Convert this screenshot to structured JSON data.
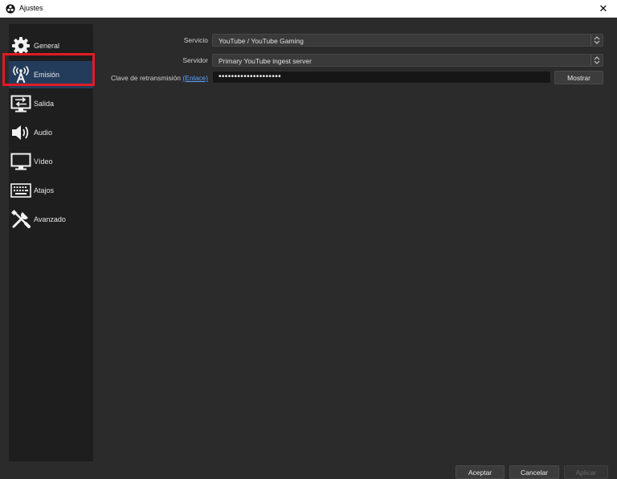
{
  "window": {
    "title": "Ajustes",
    "close_glyph": "✕"
  },
  "sidebar": {
    "items": [
      {
        "label": "General",
        "icon": "gear-icon"
      },
      {
        "label": "Emisión",
        "icon": "broadcast-antenna-icon",
        "active": true
      },
      {
        "label": "Salida",
        "icon": "output-monitor-icon"
      },
      {
        "label": "Audio",
        "icon": "speaker-icon"
      },
      {
        "label": "Vídeo",
        "icon": "monitor-icon"
      },
      {
        "label": "Atajos",
        "icon": "keyboard-icon"
      },
      {
        "label": "Avanzado",
        "icon": "wrench-screwdriver-icon"
      }
    ]
  },
  "stream": {
    "service_label": "Servicio",
    "service_value": "YouTube / YouTube Gaming",
    "server_label": "Servidor",
    "server_value": "Primary YouTube ingest server",
    "key_label": "Clave de retransmisión",
    "key_link": "(Enlace)",
    "key_value": "••••••••••••••••••••",
    "show_button": "Mostrar"
  },
  "footer": {
    "accept": "Aceptar",
    "cancel": "Cancelar",
    "apply": "Aplicar"
  },
  "colors": {
    "background": "#2b2b2b",
    "sidebar": "#1e1e1e",
    "active_item": "#243c5c",
    "highlight": "#e01b24",
    "link": "#5aa1ff"
  }
}
